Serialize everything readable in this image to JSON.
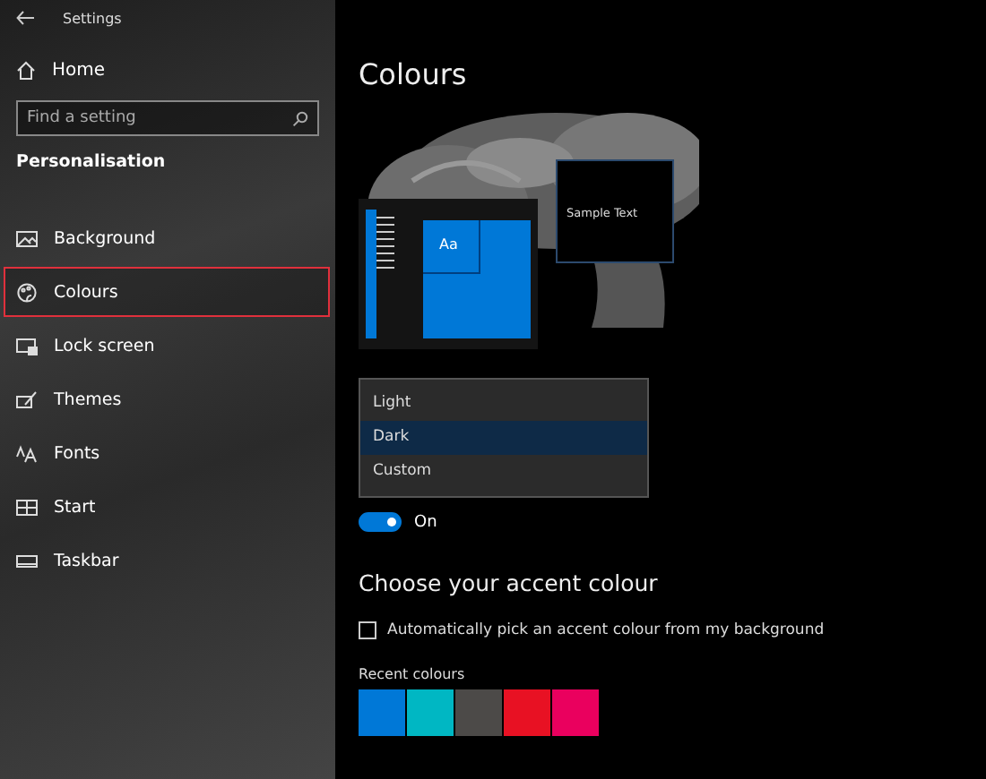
{
  "window": {
    "title": "Settings"
  },
  "sidebar": {
    "home": "Home",
    "search": {
      "placeholder": "Find a setting"
    },
    "section": "Personalisation",
    "items": [
      {
        "label": "Background",
        "selected": false
      },
      {
        "label": "Colours",
        "selected": true
      },
      {
        "label": "Lock screen",
        "selected": false
      },
      {
        "label": "Themes",
        "selected": false
      },
      {
        "label": "Fonts",
        "selected": false
      },
      {
        "label": "Start",
        "selected": false
      },
      {
        "label": "Taskbar",
        "selected": false
      }
    ]
  },
  "main": {
    "title": "Colours",
    "preview": {
      "tile_text": "Aa",
      "sample_text": "Sample Text"
    },
    "mode_menu": [
      {
        "label": "Light",
        "selected": false
      },
      {
        "label": "Dark",
        "selected": true
      },
      {
        "label": "Custom",
        "selected": false
      }
    ],
    "transparency": {
      "on": true,
      "state_text": "On"
    },
    "accent_heading": "Choose your accent colour",
    "auto_pick": {
      "label": "Automatically pick an accent colour from my background",
      "checked": false
    },
    "recent_label": "Recent colours",
    "recent_colours": [
      {
        "color": "#0078d7"
      },
      {
        "color": "#00b7c3"
      },
      {
        "color": "#4c4a48"
      },
      {
        "color": "#e81123"
      },
      {
        "color": "#ea005e"
      }
    ]
  }
}
